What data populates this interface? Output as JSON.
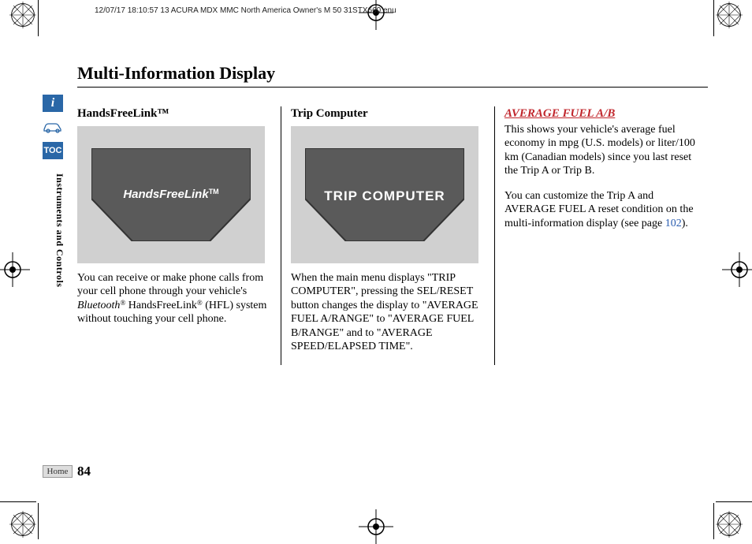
{
  "print_header": "12/07/17 18:10:57   13 ACURA MDX MMC North America Owner's M 50 31STX660 enu",
  "page_title": "Multi-Information Display",
  "side": {
    "toc_label": "TOC",
    "section_label": "Instruments and Controls",
    "home_label": "Home"
  },
  "page_number": "84",
  "col1": {
    "heading": "HandsFreeLink™",
    "display_text": "HandsFreeLink",
    "display_tm": "TM",
    "body_1": "You can receive or make phone calls from your cell phone through your vehicle's ",
    "body_bt": "Bluetooth",
    "body_reg1": "®",
    "body_hfl": " HandsFreeLink",
    "body_reg2": "®",
    "body_2": " (HFL) system without touching your cell phone."
  },
  "col2": {
    "heading": "Trip Computer",
    "display_text": "TRIP COMPUTER",
    "body": "When the main menu displays \"TRIP COMPUTER\", pressing the SEL/RESET button changes the display to \"AVERAGE FUEL A/RANGE\" to \"AVERAGE FUEL B/RANGE\" and to \"AVERAGE SPEED/ELAPSED TIME\"."
  },
  "col3": {
    "heading": "AVERAGE FUEL A/B",
    "p1": "This shows your vehicle's average fuel economy in mpg (U.S. models) or liter/100 km (Canadian models) since you last reset the Trip A or Trip B.",
    "p2_a": "You can customize the Trip A and AVERAGE FUEL A reset condition on the multi-information display (see page ",
    "p2_link": "102",
    "p2_b": ")."
  }
}
